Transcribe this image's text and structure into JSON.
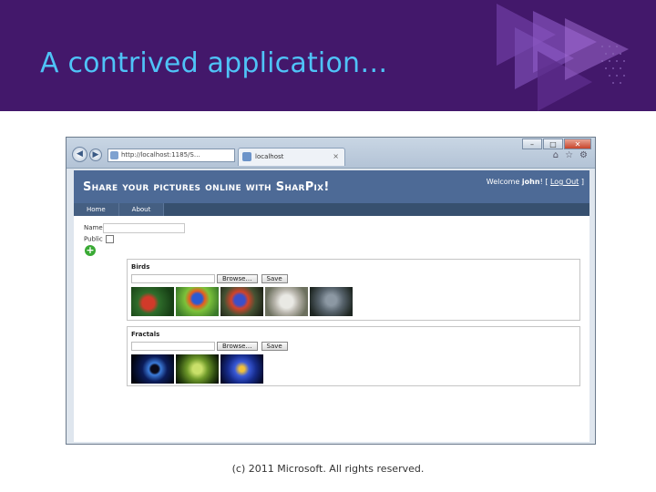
{
  "slide": {
    "title": "A contrived application…",
    "footer": "(c) 2011 Microsoft. All rights reserved."
  },
  "browser": {
    "address": "http://localhost:1185/S…",
    "tab_label": "localhost",
    "tab_close": "×",
    "window_controls": [
      "–",
      "□",
      "✕"
    ],
    "toolbar_icons": [
      "home-icon",
      "star-icon",
      "gear-icon"
    ]
  },
  "site": {
    "title": "Share your pictures online with SharPix!",
    "welcome": "Welcome ",
    "user": "john",
    "login_open": "! [ ",
    "logout_label": "Log Out",
    "login_close": " ]",
    "nav": [
      "Home",
      "About"
    ],
    "form": {
      "name_label": "Name",
      "public_label": "Public"
    },
    "albums": [
      {
        "title": "Birds",
        "browse_label": "Browse…",
        "save_label": "Save",
        "photo_count": 5
      },
      {
        "title": "Fractals",
        "browse_label": "Browse…",
        "save_label": "Save",
        "photo_count": 3
      }
    ]
  },
  "colors": {
    "slide_header": "#43186b",
    "title_text": "#4fc3f7",
    "site_header": "#4d6a96",
    "nav_bar": "#37506f"
  }
}
